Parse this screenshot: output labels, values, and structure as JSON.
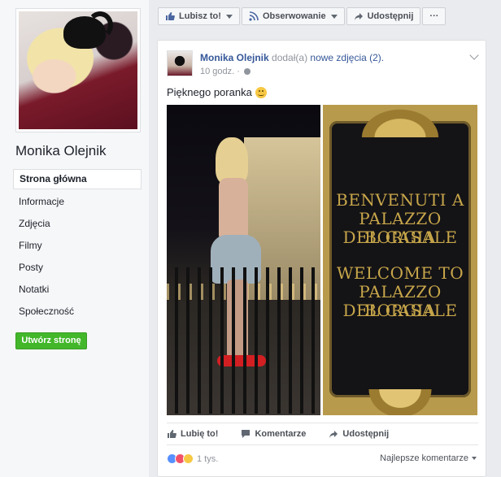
{
  "sidebar": {
    "page_name": "Monika Olejnik",
    "nav": [
      {
        "label": "Strona główna",
        "active": true
      },
      {
        "label": "Informacje"
      },
      {
        "label": "Zdjęcia"
      },
      {
        "label": "Filmy"
      },
      {
        "label": "Posty"
      },
      {
        "label": "Notatki"
      },
      {
        "label": "Społeczność"
      }
    ],
    "create_page": "Utwórz stronę"
  },
  "action_bar": {
    "like": "Lubisz to!",
    "follow": "Obserwowanie",
    "share": "Udostępnij",
    "more": "···"
  },
  "post": {
    "author": "Monika Olejnik",
    "action_text": "dodał(a)",
    "action_link": "nowe zdjęcia (2).",
    "time": "10 godz. ·",
    "text": "Pięknego poranka",
    "sign_lines": [
      "BENVENUTI A",
      "PALAZZO BORGIA",
      "DEL CASALE",
      "WELCOME TO",
      "PALAZZO BORGIA",
      "DEL CASALE"
    ],
    "buttons": {
      "like": "Lubię to!",
      "comment": "Komentarze",
      "share": "Udostępnij"
    },
    "reactions_count": "1 tys.",
    "sort_comments": "Najlepsze komentarze"
  },
  "colors": {
    "link": "#365899",
    "create_button": "#42b72a",
    "like_reaction": "#5890ff",
    "love_reaction": "#f25268",
    "wow_reaction": "#f7c844"
  }
}
